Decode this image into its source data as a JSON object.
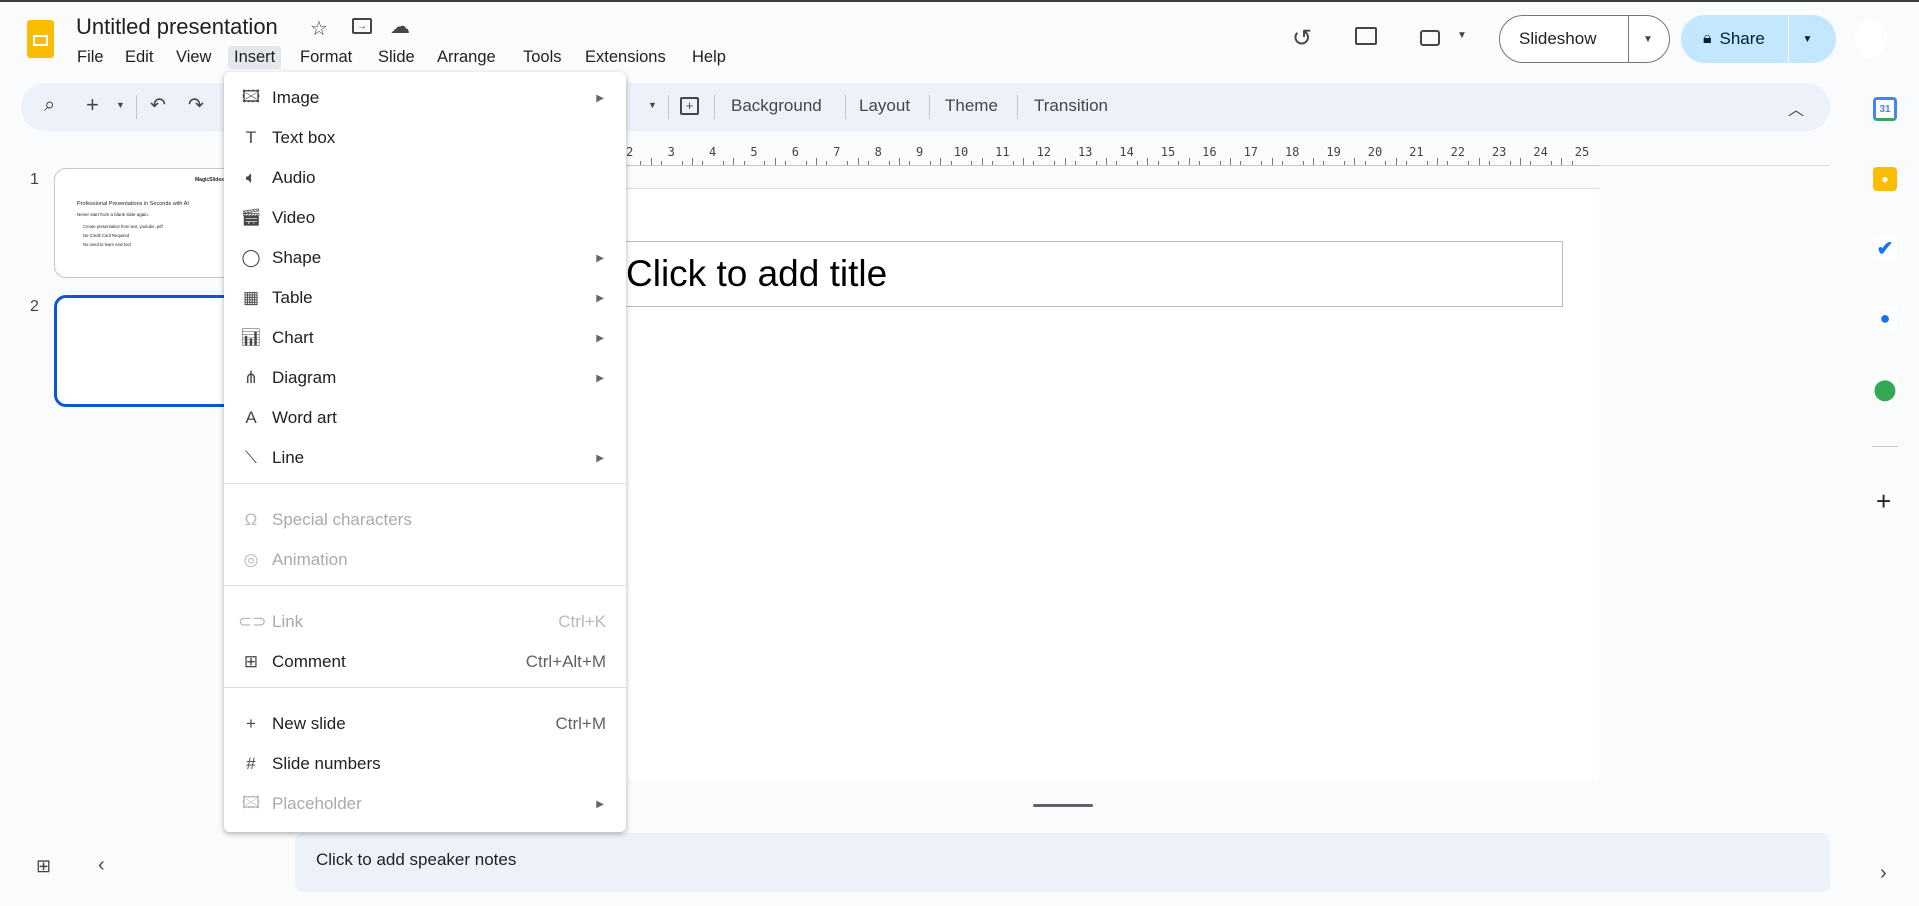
{
  "app": {
    "title": "Untitled presentation"
  },
  "menubar": [
    "File",
    "Edit",
    "View",
    "Insert",
    "Format",
    "Slide",
    "Arrange",
    "Tools",
    "Extensions",
    "Help"
  ],
  "toolbar": {
    "background": "Background",
    "layout": "Layout",
    "theme": "Theme",
    "transition": "Transition"
  },
  "header": {
    "slideshow": "Slideshow",
    "share": "Share"
  },
  "ruler": [
    2,
    3,
    4,
    5,
    6,
    7,
    8,
    9,
    10,
    11,
    12,
    13,
    14,
    15,
    16,
    17,
    18,
    19,
    20,
    21,
    22,
    23,
    24,
    25
  ],
  "slide": {
    "title_placeholder": "Click to add title"
  },
  "notes": {
    "placeholder": "Click to add speaker notes"
  },
  "filmstrip": {
    "numbers": [
      "1",
      "2"
    ],
    "thumb1": {
      "logo": "MagicSlides",
      "heading": "Professional Presentations in Seconds with AI",
      "sub": "Never start from a blank slide again.",
      "bullets": [
        "Create presentation from text, youtube, pdf",
        "No Credit Card Required",
        "No need to learn new tool"
      ]
    }
  },
  "insert_menu": {
    "groups": [
      [
        {
          "label": "Image",
          "icon": "image-icon",
          "submenu": true
        },
        {
          "label": "Text box",
          "icon": "text-box-icon"
        },
        {
          "label": "Audio",
          "icon": "audio-icon"
        },
        {
          "label": "Video",
          "icon": "video-icon"
        },
        {
          "label": "Shape",
          "icon": "shape-icon",
          "submenu": true
        },
        {
          "label": "Table",
          "icon": "table-icon",
          "submenu": true
        },
        {
          "label": "Chart",
          "icon": "chart-icon",
          "submenu": true
        },
        {
          "label": "Diagram",
          "icon": "diagram-icon",
          "submenu": true
        },
        {
          "label": "Word art",
          "icon": "word-art-icon"
        },
        {
          "label": "Line",
          "icon": "line-icon",
          "submenu": true
        }
      ],
      [
        {
          "label": "Special characters",
          "icon": "omega-icon",
          "disabled": true
        },
        {
          "label": "Animation",
          "icon": "animation-icon",
          "disabled": true
        }
      ],
      [
        {
          "label": "Link",
          "icon": "link-icon",
          "disabled": true,
          "shortcut": "Ctrl+K"
        },
        {
          "label": "Comment",
          "icon": "comment-add-icon",
          "shortcut": "Ctrl+Alt+M"
        }
      ],
      [
        {
          "label": "New slide",
          "icon": "plus-icon",
          "shortcut": "Ctrl+M"
        },
        {
          "label": "Slide numbers",
          "icon": "hash-icon"
        },
        {
          "label": "Placeholder",
          "icon": "placeholder-icon",
          "disabled": true,
          "submenu": true
        }
      ]
    ]
  },
  "side_panel": {
    "calendar_day": "31"
  },
  "colors": {
    "accent": "#0b57d0",
    "share_bg": "#c2e7ff",
    "toolbar_bg": "#edf2fa"
  }
}
